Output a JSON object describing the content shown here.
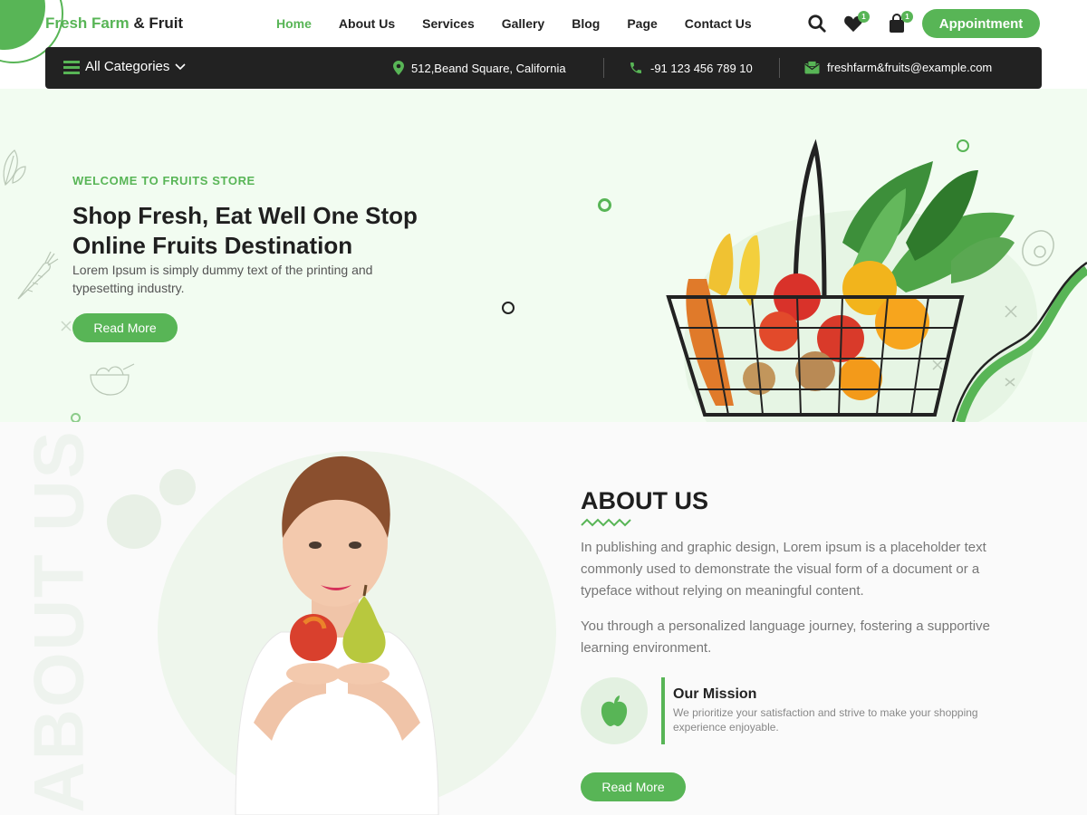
{
  "header": {
    "logo_green": "Fresh Farm",
    "logo_dark": "& Fruit",
    "nav": [
      "Home",
      "About Us",
      "Services",
      "Gallery",
      "Blog",
      "Page",
      "Contact Us"
    ],
    "active_nav": "Home",
    "wishlist_count": "1",
    "cart_count": "1",
    "appointment_label": "Appointment"
  },
  "infobar": {
    "categories_label": "All Categories",
    "address": "512,Beand Square, California",
    "phone": "-91 123 456 789 10",
    "email": "freshfarm&fruits@example.com"
  },
  "hero": {
    "subtitle": "WELCOME TO FRUITS STORE",
    "title": "Shop Fresh, Eat Well One Stop Online Fruits Destination",
    "description": "Lorem Ipsum is simply dummy text of the printing and typesetting industry.",
    "button_label": "Read More"
  },
  "about": {
    "watermark": "ABOUT US",
    "title": "ABOUT US",
    "paragraph1": "In publishing and graphic design, Lorem ipsum is a placeholder text commonly used to demonstrate the visual form of a document or a typeface without relying on meaningful content.",
    "paragraph2": "You through a personalized language journey, fostering a supportive learning environment.",
    "mission_title": "Our Mission",
    "mission_text": "We prioritize your satisfaction and strive to make your shopping experience enjoyable.",
    "button_label": "Read More"
  },
  "colors": {
    "accent": "#58b556",
    "dark_bar": "#222222",
    "hero_bg": "#f2fcf1",
    "about_bg": "#fafafa"
  },
  "icons": {
    "menu": "hamburger-icon",
    "dropdown": "chevron-down-icon",
    "location": "map-pin-icon",
    "phone": "phone-icon",
    "email": "mail-icon",
    "search": "search-icon",
    "wishlist": "heart-icon",
    "cart": "shopping-bag-icon",
    "mission": "apple-icon"
  }
}
